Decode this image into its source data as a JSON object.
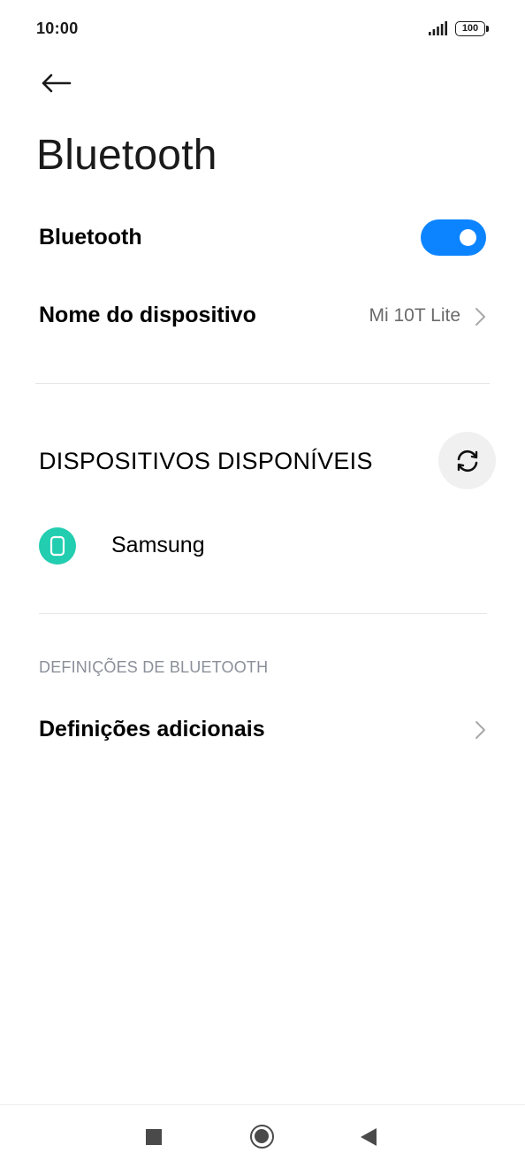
{
  "status_bar": {
    "time": "10:00",
    "battery_level": "100",
    "icons": [
      "signal-icon",
      "battery-icon"
    ]
  },
  "header": {
    "back_icon": "arrow-left-icon",
    "title": "Bluetooth"
  },
  "bluetooth_toggle": {
    "label": "Bluetooth",
    "enabled": true,
    "accent_color": "#0d84ff"
  },
  "device_name_row": {
    "label": "Nome do dispositivo",
    "value": "Mi 10T Lite"
  },
  "available_devices": {
    "header": "DISPOSITIVOS DISPONÍVEIS",
    "refresh_icon": "refresh-icon",
    "devices": [
      {
        "name": "Samsung",
        "icon": "phone-icon",
        "icon_color": "#22cdb0"
      }
    ]
  },
  "bluetooth_settings": {
    "caption": "DEFINIÇÕES DE BLUETOOTH",
    "additional_label": "Definições adicionais"
  },
  "nav_bar": {
    "icons": [
      "recents-icon",
      "home-icon",
      "back-icon"
    ]
  }
}
